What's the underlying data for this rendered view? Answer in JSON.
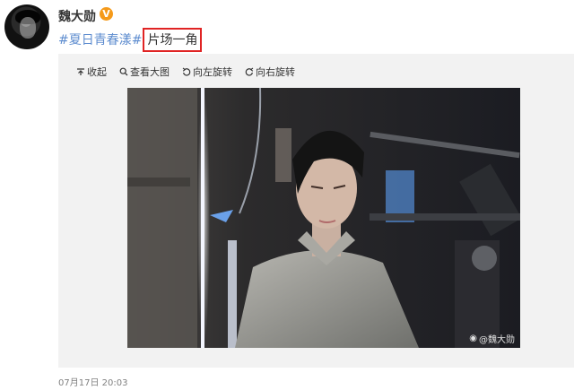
{
  "post": {
    "username": "魏大勋",
    "verified_badge": "V",
    "hashtag": "#夏日青春漾#",
    "text": "片场一角",
    "timestamp": "07月17日 20:03"
  },
  "toolbar": {
    "collapse_label": "收起",
    "view_large_label": "查看大图",
    "rotate_left_label": "向左旋转",
    "rotate_right_label": "向右旋转"
  },
  "photo": {
    "watermark": "@魏大勋"
  },
  "colors": {
    "hashtag": "#5d8ccf",
    "highlight_border": "#e02424",
    "verified_badge": "#f59a1a"
  }
}
